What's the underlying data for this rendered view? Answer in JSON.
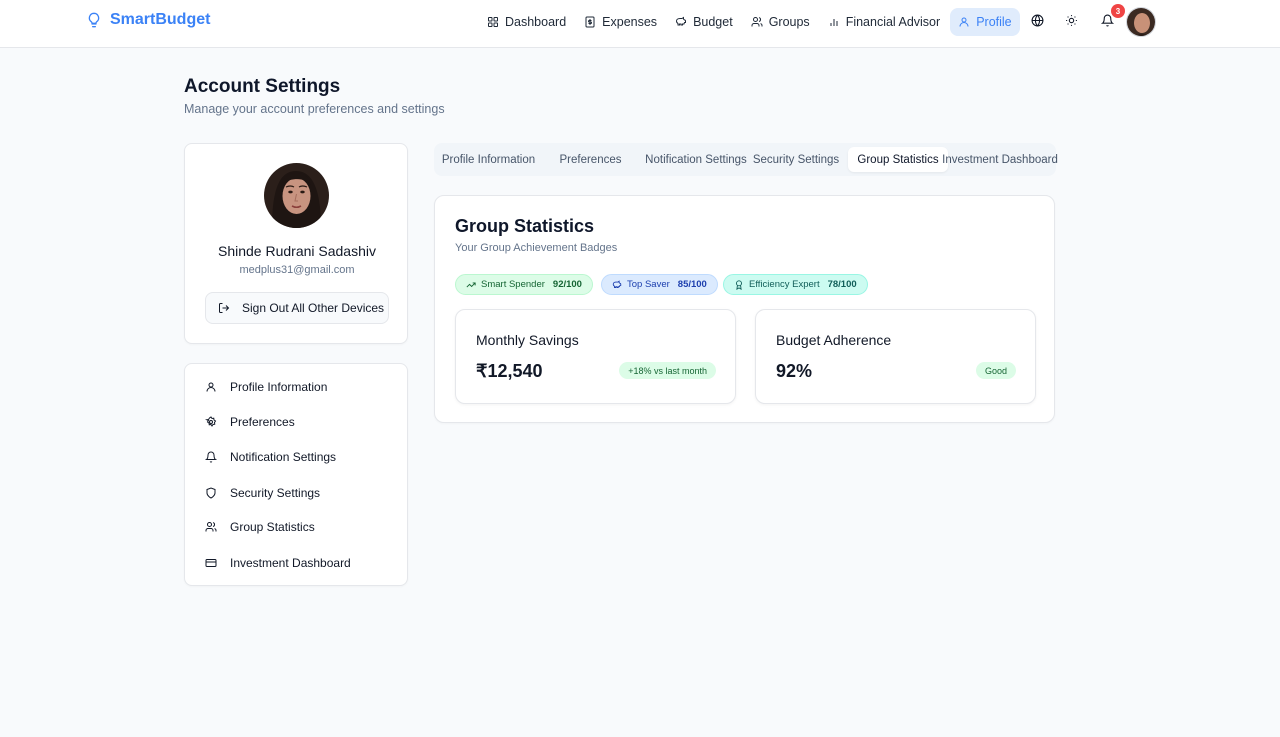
{
  "brand": {
    "name": "SmartBudget",
    "color": "#3b82f6"
  },
  "nav": {
    "items": [
      {
        "label": "Dashboard",
        "icon": "grid-icon",
        "active": false
      },
      {
        "label": "Expenses",
        "icon": "receipt-icon",
        "active": false
      },
      {
        "label": "Budget",
        "icon": "piggy-bank-icon",
        "active": false
      },
      {
        "label": "Groups",
        "icon": "users-icon",
        "active": false
      },
      {
        "label": "Financial Advisor",
        "icon": "bar-chart-icon",
        "active": false
      },
      {
        "label": "Profile",
        "icon": "user-icon",
        "active": true
      }
    ],
    "notification_count": "3"
  },
  "page": {
    "title": "Account Settings",
    "subtitle": "Manage your account preferences and settings"
  },
  "profile": {
    "name": "Shinde Rudrani Sadashiv",
    "email": "medplus31@gmail.com",
    "signout_label": "Sign Out All Other Devices"
  },
  "side_menu": {
    "items": [
      {
        "label": "Profile Information",
        "icon": "user-icon"
      },
      {
        "label": "Preferences",
        "icon": "gear-icon"
      },
      {
        "label": "Notification Settings",
        "icon": "bell-icon"
      },
      {
        "label": "Security Settings",
        "icon": "shield-icon"
      },
      {
        "label": "Group Statistics",
        "icon": "users-icon"
      },
      {
        "label": "Investment Dashboard",
        "icon": "credit-card-icon"
      }
    ]
  },
  "tabs": {
    "items": [
      {
        "label": "Profile Information",
        "active": false
      },
      {
        "label": "Preferences",
        "active": false
      },
      {
        "label": "Notification Settings",
        "active": false
      },
      {
        "label": "Security Settings",
        "active": false
      },
      {
        "label": "Group Statistics",
        "active": true
      },
      {
        "label": "Investment Dashboard",
        "active": false
      }
    ]
  },
  "group_stats": {
    "title": "Group Statistics",
    "subtitle": "Your Group Achievement Badges",
    "badges": [
      {
        "label": "Smart Spender",
        "score": "92/100",
        "icon": "trending-up-icon",
        "color": "#166534"
      },
      {
        "label": "Top Saver",
        "score": "85/100",
        "icon": "piggy-bank-icon",
        "color": "#1e40af"
      },
      {
        "label": "Efficiency Expert",
        "score": "78/100",
        "icon": "award-icon",
        "color": "#115e59"
      }
    ],
    "cards": [
      {
        "label": "Monthly Savings",
        "value": "₹12,540",
        "tag": "+18% vs last month"
      },
      {
        "label": "Budget Adherence",
        "value": "92%",
        "tag": "Good"
      }
    ]
  }
}
